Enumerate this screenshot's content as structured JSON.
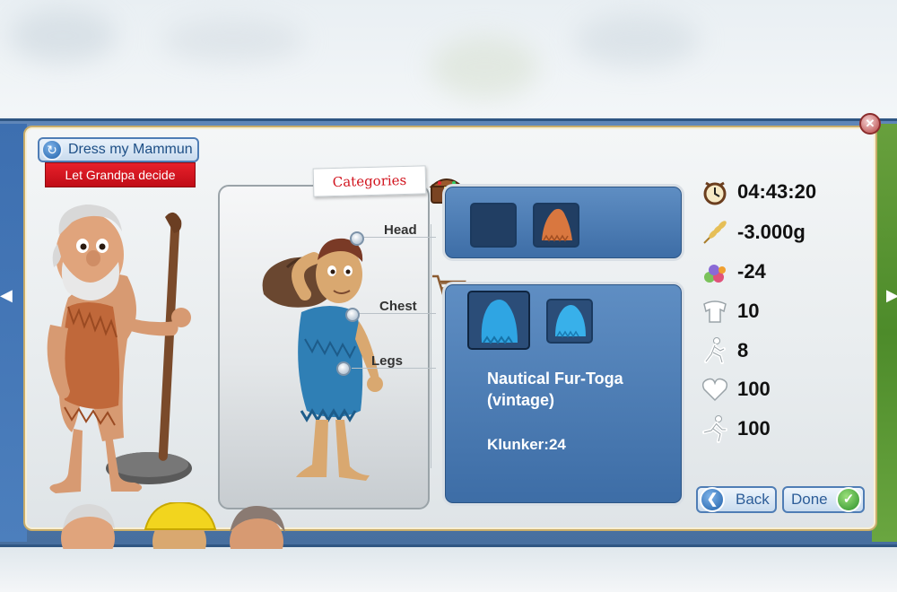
{
  "header": {
    "dress_button_label": "Dress my Mammun",
    "grandpa_button_label": "Let Grandpa decide"
  },
  "categories": {
    "tab_label": "Categories",
    "slots": [
      {
        "label": "Head"
      },
      {
        "label": "Chest"
      },
      {
        "label": "Legs"
      }
    ]
  },
  "item": {
    "name_line1": "Nautical Fur-Toga",
    "name_line2": "(vintage)",
    "price": "Klunker:24"
  },
  "stats": {
    "timer": "04:43:20",
    "gold": "-3.000g",
    "food": "-24",
    "strength": "10",
    "agility": "8",
    "health": "100",
    "speed": "100"
  },
  "buttons": {
    "back": "Back",
    "done": "Done"
  },
  "colors": {
    "frame_blue": "#476f9f",
    "panel_bg": "#eef1f3",
    "gold_border": "#c9ad6a",
    "red_button": "#d0121b",
    "item_panel_blue": "#4a7ab3",
    "fur_orange": "#d9773f",
    "fur_blue": "#2fa5e3",
    "done_green": "#3aa63a"
  },
  "icons": [
    "refresh-icon",
    "chest-icon",
    "cart-icon",
    "alarm-clock-icon",
    "wheat-icon",
    "food-pile-icon",
    "torso-icon",
    "runner-icon",
    "heart-icon",
    "sprinter-icon",
    "back-arrow-icon",
    "check-icon",
    "close-icon"
  ]
}
